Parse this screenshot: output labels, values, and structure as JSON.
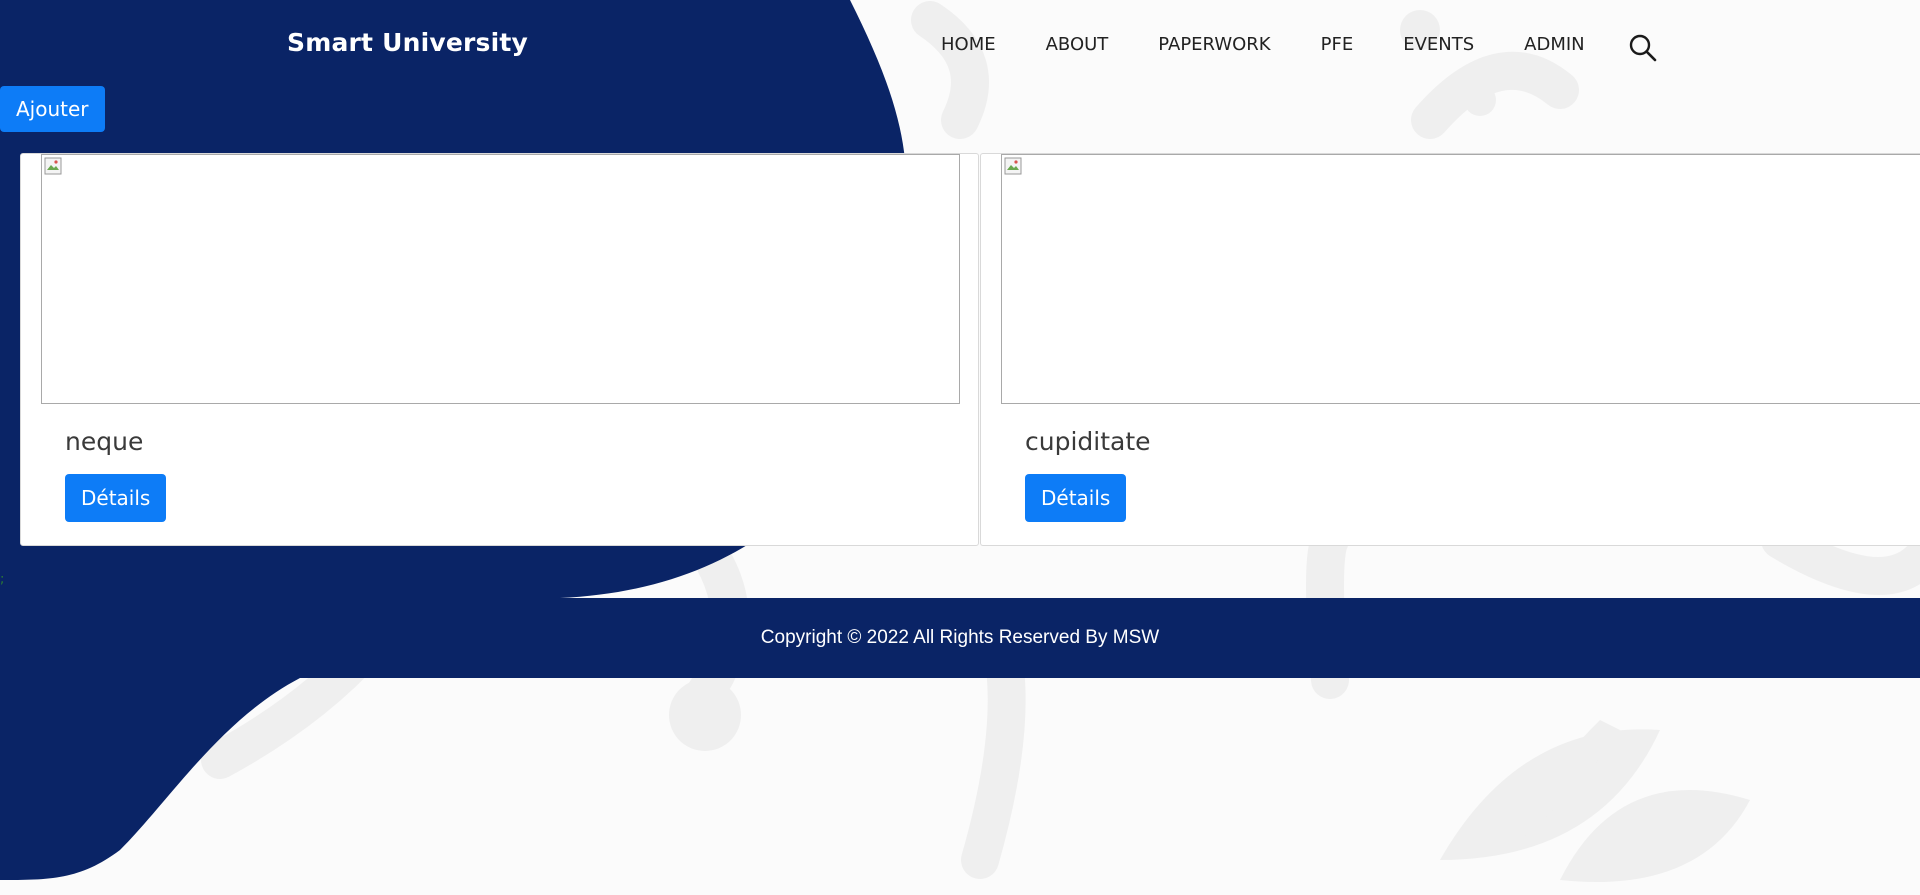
{
  "brand": "Smart University",
  "nav": {
    "links": [
      "HOME",
      "ABOUT",
      "PAPERWORK",
      "PFE",
      "EVENTS",
      "ADMIN"
    ],
    "search_icon": "search-icon"
  },
  "actions": {
    "add_label": "Ajouter"
  },
  "cards": [
    {
      "title": "neque",
      "button_label": "Détails",
      "image_icon": "broken-image-icon"
    },
    {
      "title": "cupiditate",
      "button_label": "Détails",
      "image_icon": "broken-image-icon"
    }
  ],
  "stray_text": ";",
  "footer": {
    "copyright": "Copyright © 2022 All Rights Reserved By MSW"
  },
  "colors": {
    "navy": "#0a2466",
    "button_blue": "#0d7cf7",
    "background": "#fbfbfb"
  }
}
